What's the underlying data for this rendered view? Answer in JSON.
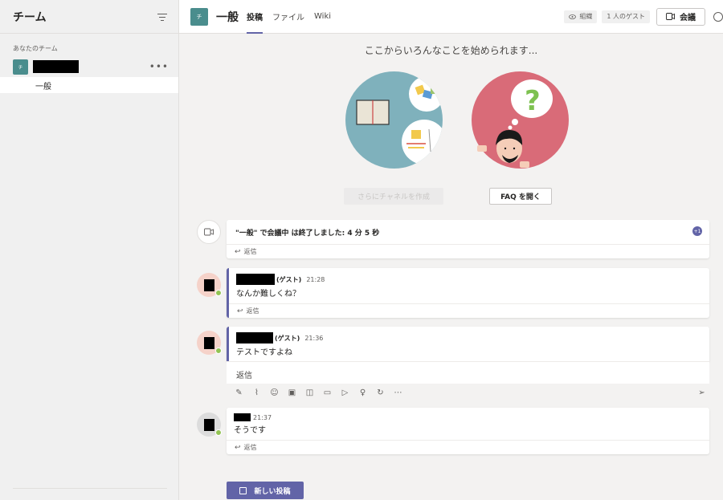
{
  "sidebar": {
    "title": "チーム",
    "section_label": "あなたのチーム",
    "team_avatar_text": "チ",
    "channel_label": "一般"
  },
  "header": {
    "channel_avatar_text": "チ",
    "channel_name": "一般",
    "tabs": [
      {
        "label": "投稿",
        "active": true
      },
      {
        "label": "ファイル",
        "active": false
      },
      {
        "label": "Wiki",
        "active": false
      }
    ],
    "org_label": "組織",
    "guest_label": "1 人のゲスト",
    "meet_label": "会議"
  },
  "welcome": {
    "title": "ここからいろんなことを始められます...",
    "create_channel_label": "さらにチャネルを作成",
    "faq_label": "FAQ を開く"
  },
  "meeting_card": {
    "text": "\"一般\" で会議中 は終了しました: 4 分 5 秒",
    "badge": "+1",
    "reply_label": "返信"
  },
  "messages": [
    {
      "guest_tag": "(ゲスト)",
      "time": "21:28",
      "text": "なんか難しくね？",
      "reply_label": "返信"
    },
    {
      "guest_tag": "(ゲスト)",
      "time": "21:36",
      "text": "テストですよね",
      "reply_placeholder": "返信"
    },
    {
      "time": "21:37",
      "text": "そうです",
      "reply_label": "返信"
    }
  ],
  "new_post_label": "新しい投稿",
  "colors": {
    "accent": "#6264a7",
    "team_avatar": "#4a8d8d",
    "presence": "#92c353",
    "illustration_left": "#7fb1bc",
    "illustration_right": "#d96b78"
  }
}
